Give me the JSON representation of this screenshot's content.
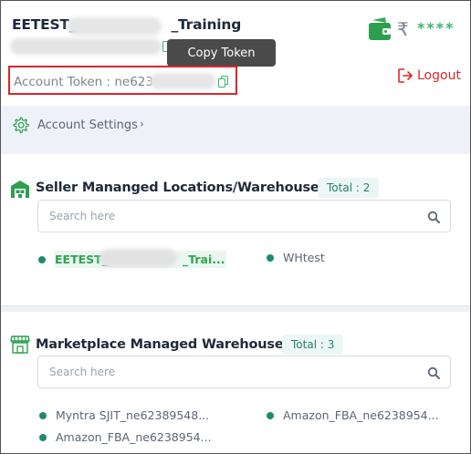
{
  "header": {
    "account_name": "EETEST_",
    "account_name_suffix": "_Training",
    "token_label": "Account Token : ne623",
    "tooltip": "Copy Token",
    "currency_symbol": "₹",
    "balance_masked": "****",
    "logout_label": "Logout"
  },
  "settings": {
    "label": "Account Settings",
    "chevron": "›"
  },
  "seller_section": {
    "title": "Seller Mananged Locations/Warehouses",
    "badge": "Total : 2",
    "search_placeholder": "Search here",
    "locations": [
      "EETEST_",
      "_Trai...",
      "WHtest"
    ]
  },
  "marketplace_section": {
    "title": "Marketplace Managed Warehouses",
    "badge": "Total : 3",
    "search_placeholder": "Search here",
    "warehouses": [
      "Myntra SJIT_ne62389548...",
      "Amazon_FBA_ne6238954...",
      "Amazon_FBA_ne6238954..."
    ]
  },
  "colors": {
    "accent_green": "#3cb371",
    "danger_red": "#d9262c",
    "dot_teal": "#1f8a70"
  }
}
